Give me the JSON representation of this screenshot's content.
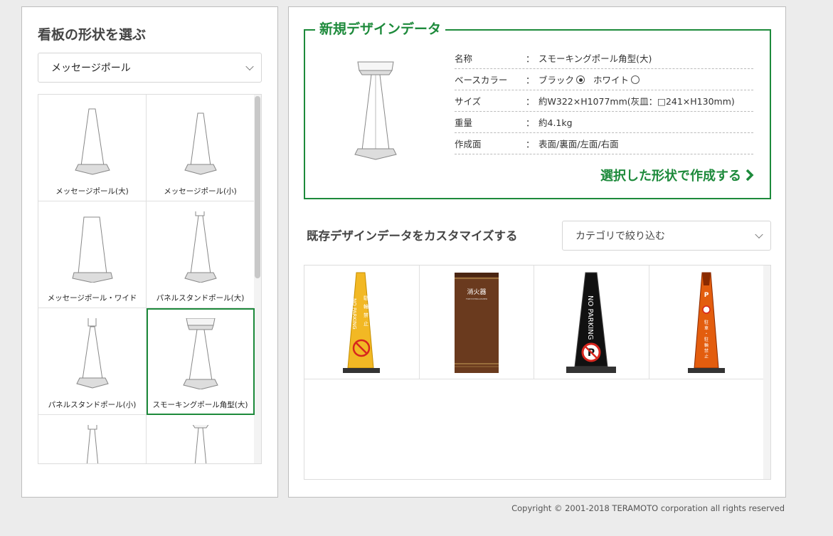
{
  "left_panel": {
    "title": "看板の形状を選ぶ",
    "select_value": "メッセージポール",
    "shapes": [
      {
        "label": "メッセージポール(大)",
        "icon": "message-pole-large-icon"
      },
      {
        "label": "メッセージポール(小)",
        "icon": "message-pole-small-icon"
      },
      {
        "label": "メッセージポール・ワイド",
        "icon": "message-pole-wide-icon"
      },
      {
        "label": "パネルスタンドポール(大)",
        "icon": "panel-stand-pole-large-icon"
      },
      {
        "label": "パネルスタンドポール(小)",
        "icon": "panel-stand-pole-small-icon"
      },
      {
        "label": "スモーキングポール角型(大)",
        "icon": "smoking-pole-square-large-icon",
        "selected": true
      },
      {
        "label": "",
        "icon": "pole-partial-icon"
      },
      {
        "label": "",
        "icon": "pole-partial-icon"
      }
    ]
  },
  "new_design": {
    "title": "新規デザインデータ",
    "specs": [
      {
        "key": "名称",
        "value": "スモーキングポール角型(大)"
      },
      {
        "key": "ベースカラー",
        "value": ""
      },
      {
        "key": "サイズ",
        "value": "約W322×H1077mm(灰皿：□241×H130mm)"
      },
      {
        "key": "重量",
        "value": "約4.1kg"
      },
      {
        "key": "作成面",
        "value": "表面/裏面/左面/右面"
      }
    ],
    "colon": "：",
    "base_color_options": [
      {
        "label": "ブラック",
        "checked": true
      },
      {
        "label": "ホワイト",
        "checked": false
      }
    ],
    "create_label": "選択した形状で作成する",
    "accent_color": "#1d8a3b"
  },
  "existing": {
    "title": "既存デザインデータをカスタマイズする",
    "filter_placeholder": "カテゴリで絞り込む",
    "designs": [
      {
        "name": "yellow-no-parking-pole",
        "text": "NO PARKING",
        "sub": "駐輪禁止",
        "color": "#f2b824"
      },
      {
        "name": "wood-fire-extinguisher-sign",
        "text": "消火器",
        "sub": "FIRE EXTINGUISHER",
        "color": "#6a3a1e"
      },
      {
        "name": "black-no-parking-pole",
        "text": "NO PARKING",
        "sub": "",
        "color": "#111111"
      },
      {
        "name": "orange-no-parking-pole",
        "text": "P",
        "sub": "駐車・駐輪禁止",
        "color": "#e35d0e"
      }
    ]
  },
  "footer": {
    "copyright": "Copyright © 2001-2018 TERAMOTO corporation all rights reserved"
  }
}
